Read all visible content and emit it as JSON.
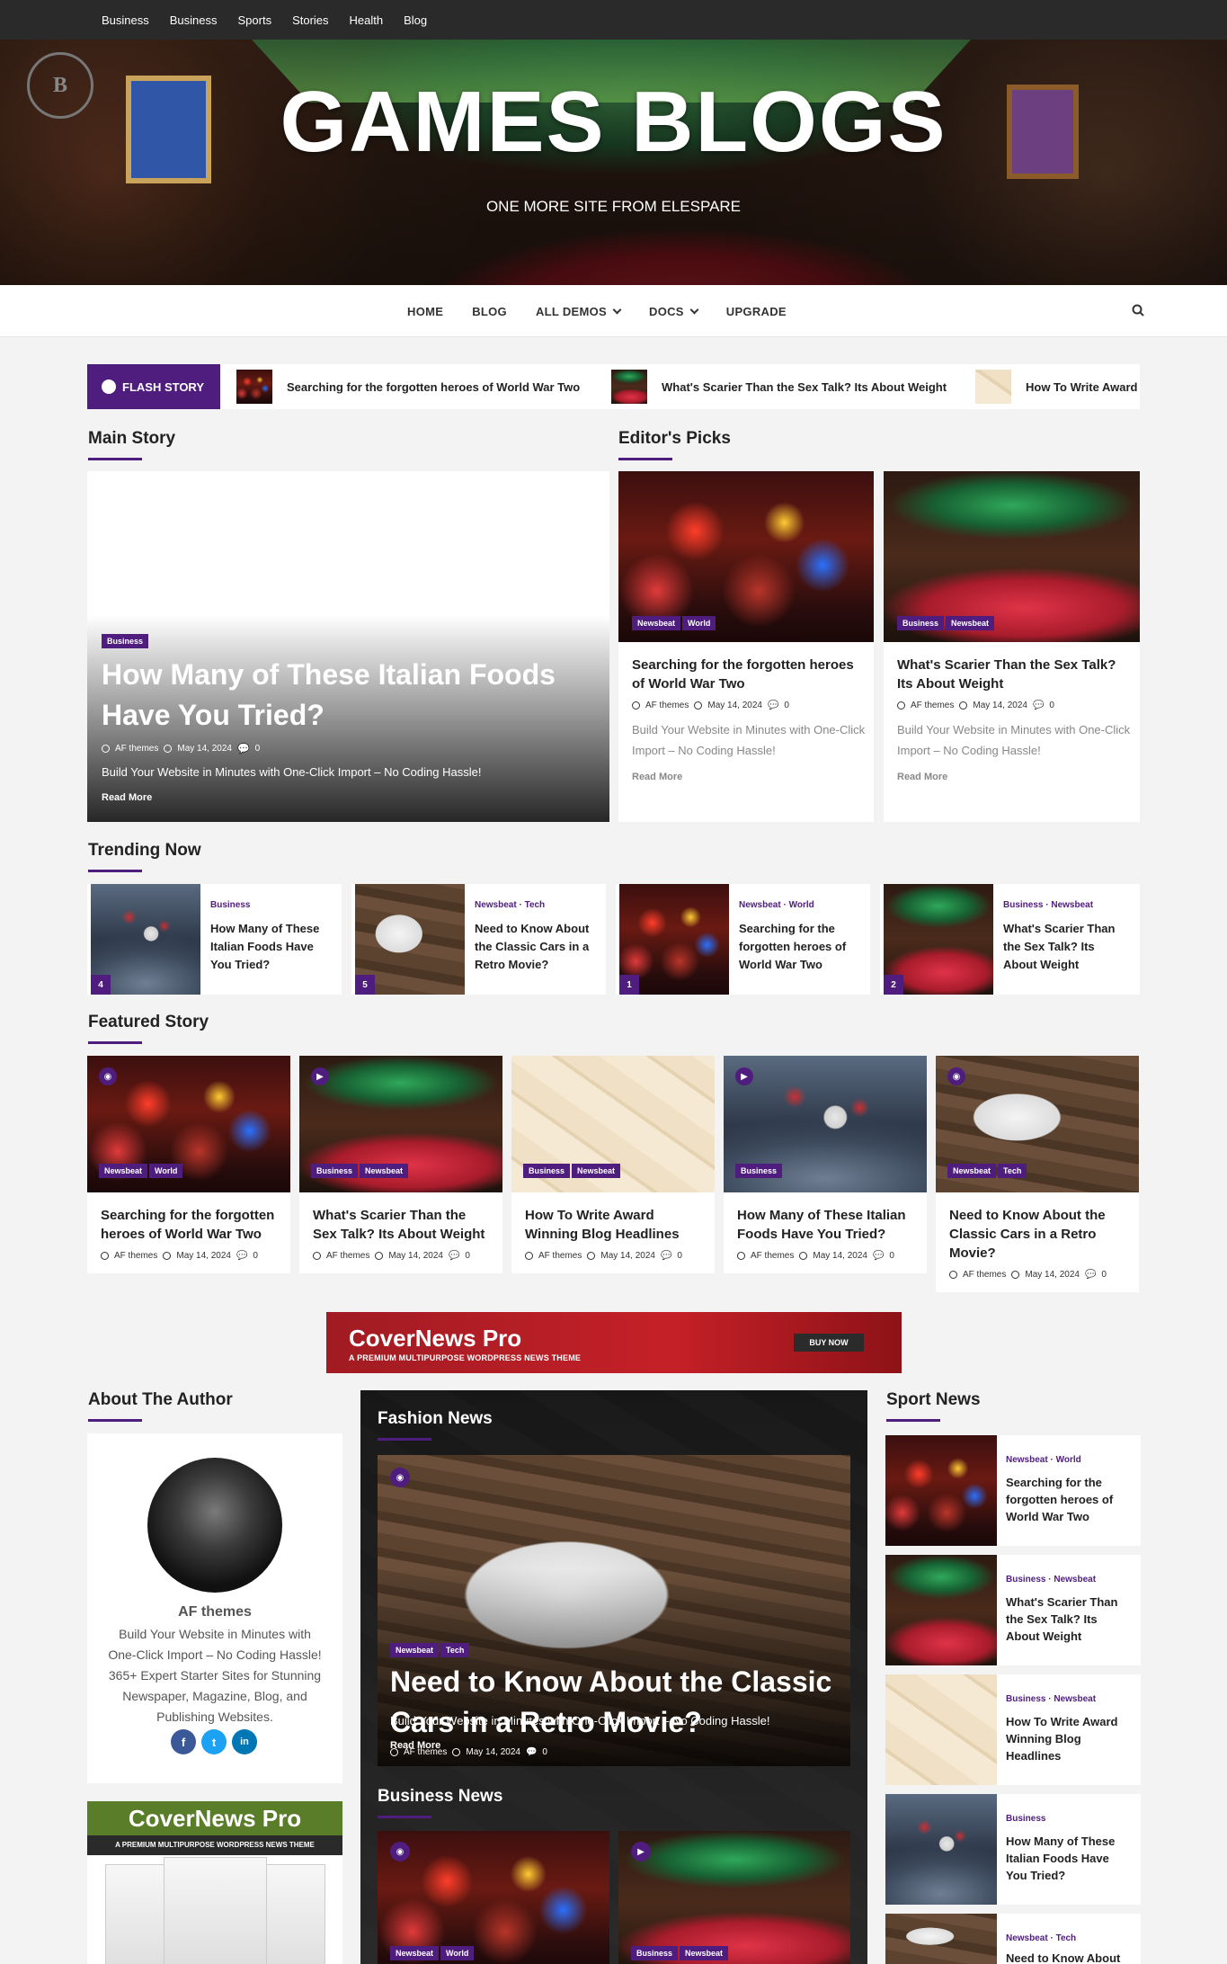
{
  "topbar": {
    "links": [
      "Business",
      "Business",
      "Sports",
      "Stories",
      "Health",
      "Blog"
    ]
  },
  "header": {
    "title": "GAMES BLOGS",
    "tagline": "ONE MORE SITE FROM ELESPARE"
  },
  "nav": {
    "items": [
      "HOME",
      "BLOG",
      "ALL DEMOS",
      "DOCS",
      "UPGRADE"
    ]
  },
  "flash": {
    "label": "FLASH STORY",
    "items": [
      "Searching for the forgotten heroes of World War Two",
      "What's Scarier Than the Sex Talk? Its About Weight",
      "How To Write Award"
    ]
  },
  "sections": {
    "main": "Main Story",
    "editors": "Editor's Picks",
    "trending": "Trending Now",
    "featured": "Featured Story",
    "author": "About The Author",
    "fashion": "Fashion News",
    "business": "Business News",
    "sport": "Sport News"
  },
  "main_story": {
    "tag": "Business",
    "title": "How Many of These Italian Foods Have You Tried?",
    "author": "AF themes",
    "date": "May 14, 2024",
    "comments": "0",
    "excerpt": "Build Your Website in Minutes with One-Click Import – No Coding Hassle!",
    "read_more": "Read More"
  },
  "editors": [
    {
      "tags": [
        "Newsbeat",
        "World"
      ],
      "title": "Searching for the forgotten heroes of World War Two",
      "author": "AF themes",
      "date": "May 14, 2024",
      "comments": "0",
      "excerpt": "Build Your Website in Minutes with One-Click Import – No Coding Hassle!",
      "read_more": "Read More"
    },
    {
      "tags": [
        "Business",
        "Newsbeat"
      ],
      "title": "What's Scarier Than the Sex Talk? Its About Weight",
      "author": "AF themes",
      "date": "May 14, 2024",
      "comments": "0",
      "excerpt": "Build Your Website in Minutes with One-Click Import – No Coding Hassle!",
      "read_more": "Read More"
    }
  ],
  "trending": [
    {
      "cats": "Business",
      "title": "How Many of These Italian Foods Have You Tried?",
      "num": "4"
    },
    {
      "cats": "Newsbeat · Tech",
      "title": "Need to Know About the Classic Cars in a Retro Movie?",
      "num": "5"
    },
    {
      "cats": "Newsbeat · World",
      "title": "Searching for the forgotten heroes of World War Two",
      "num": "1"
    },
    {
      "cats": "Business · Newsbeat",
      "title": "What's Scarier Than the Sex Talk? Its About Weight",
      "num": "2"
    }
  ],
  "featured": [
    {
      "tags": [
        "Newsbeat",
        "World"
      ],
      "title": "Searching for the forgotten heroes of World War Two",
      "author": "AF themes",
      "date": "May 14, 2024",
      "comments": "0"
    },
    {
      "tags": [
        "Business",
        "Newsbeat"
      ],
      "title": "What's Scarier Than the Sex Talk? Its About Weight",
      "author": "AF themes",
      "date": "May 14, 2024",
      "comments": "0"
    },
    {
      "tags": [
        "Business",
        "Newsbeat"
      ],
      "title": "How To Write Award Winning Blog Headlines",
      "author": "AF themes",
      "date": "May 14, 2024",
      "comments": "0"
    },
    {
      "tags": [
        "Business"
      ],
      "title": "How Many of These Italian Foods Have You Tried?",
      "author": "AF themes",
      "date": "May 14, 2024",
      "comments": "0"
    },
    {
      "tags": [
        "Newsbeat",
        "Tech"
      ],
      "title": "Need to Know About the Classic Cars in a Retro Movie?",
      "author": "AF themes",
      "date": "May 14, 2024",
      "comments": "0"
    }
  ],
  "banner": {
    "title": "CoverNews Pro",
    "subtitle": "A PREMIUM MULTIPURPOSE WORDPRESS NEWS THEME",
    "button": "BUY NOW"
  },
  "author": {
    "name": "AF themes",
    "bio": "Build Your Website in Minutes with One-Click Import – No Coding Hassle! 365+ Expert Starter Sites for Stunning Newspaper, Magazine, Blog, and Publishing Websites.",
    "social": [
      "f",
      "t",
      "in"
    ]
  },
  "promo": {
    "title": "CoverNews Pro",
    "subtitle": "A PREMIUM MULTIPURPOSE WORDPRESS NEWS THEME"
  },
  "fashion": {
    "tags": [
      "Newsbeat",
      "Tech"
    ],
    "title": "Need to Know About the Classic Cars in a Retro Movie?",
    "author": "AF themes",
    "date": "May 14, 2024",
    "comments": "0",
    "excerpt": "Build Your Website in Minutes with One-Click Import – No Coding Hassle!",
    "read_more": "Read More"
  },
  "business_news": [
    {
      "tags": [
        "Newsbeat",
        "World"
      ]
    },
    {
      "tags": [
        "Business",
        "Newsbeat"
      ]
    }
  ],
  "sport": [
    {
      "cats": "Newsbeat · World",
      "title": "Searching for the forgotten heroes of World War Two"
    },
    {
      "cats": "Business · Newsbeat",
      "title": "What's Scarier Than the Sex Talk? Its About Weight"
    },
    {
      "cats": "Business · Newsbeat",
      "title": "How To Write Award Winning Blog Headlines"
    },
    {
      "cats": "Business",
      "title": "How Many of These Italian Foods Have You Tried?"
    },
    {
      "cats": "Newsbeat · Tech",
      "title": "Need to Know About"
    }
  ],
  "colors": {
    "accent": "#4e1d7d",
    "topbar": "#2a2a2a",
    "banner_red": "#c52028"
  }
}
